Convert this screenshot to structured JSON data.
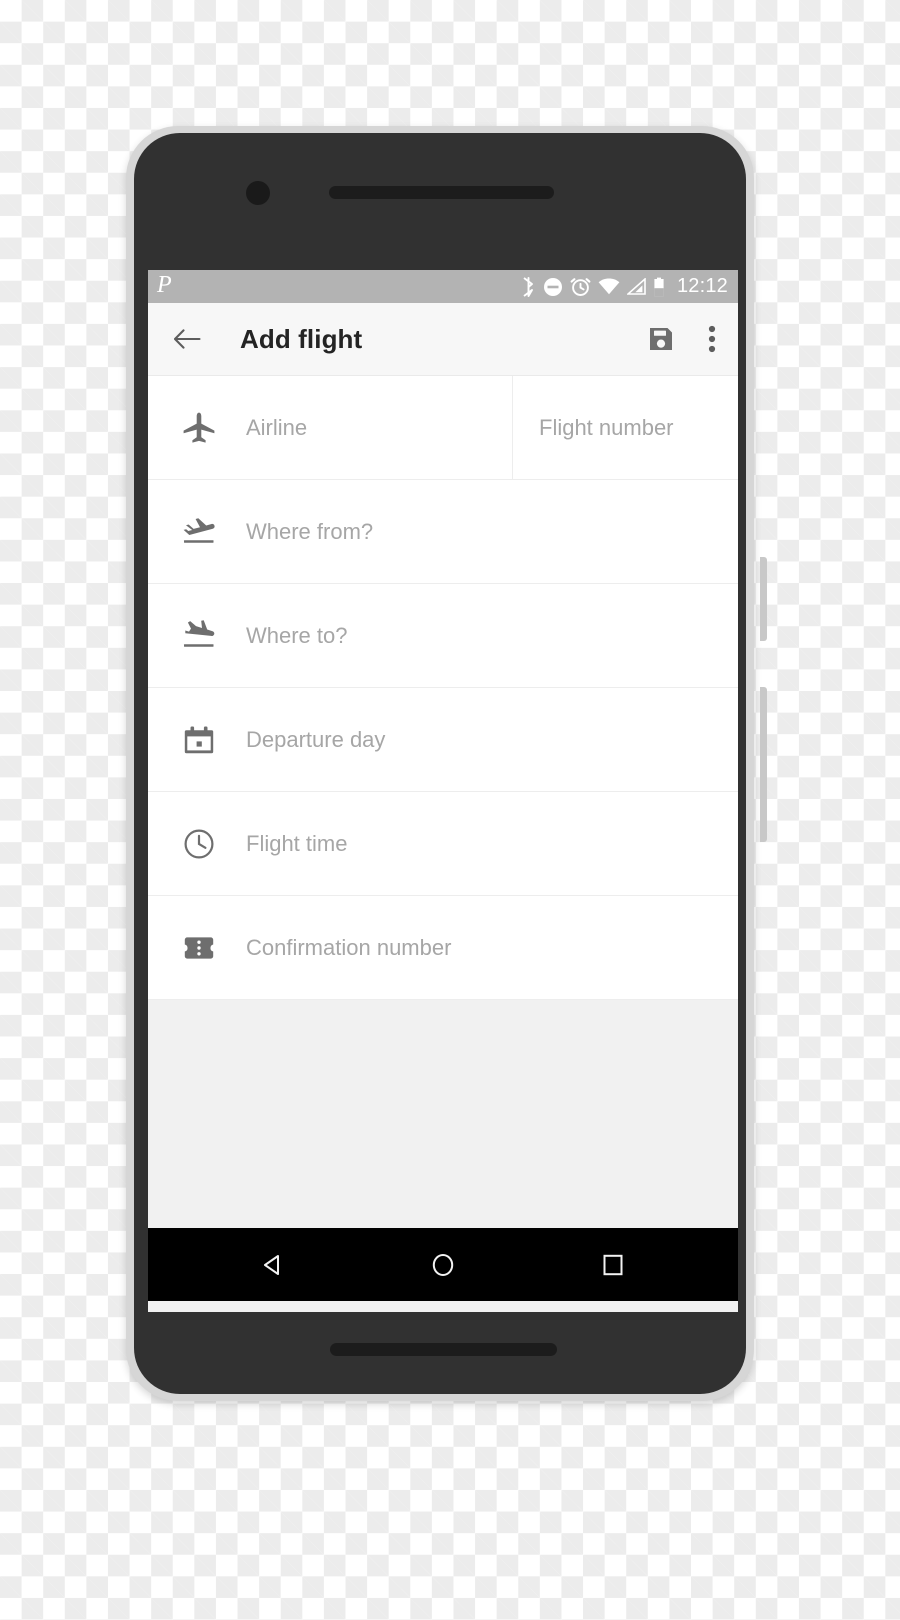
{
  "status_bar": {
    "app_logo": "P",
    "clock": "12:12",
    "icons": [
      "bluetooth-icon",
      "do-not-disturb-icon",
      "alarm-icon",
      "wifi-icon",
      "cellular-signal-icon",
      "battery-icon"
    ],
    "background_color": "#b3b3b3",
    "foreground_color": "#ffffff"
  },
  "toolbar": {
    "back_icon": "arrow-back-icon",
    "title": "Add flight",
    "save_icon": "save-floppy-disk-icon",
    "overflow_icon": "more-vert-icon",
    "background_color": "#f7f7f7",
    "title_color": "#242424"
  },
  "form": {
    "placeholder_color": "#a6a6a6",
    "icon_color": "#6e6e6e",
    "rows": [
      {
        "icon": "airplane-icon",
        "placeholder": "Airline",
        "value": "",
        "secondary_field": {
          "placeholder": "Flight number",
          "value": ""
        }
      },
      {
        "icon": "flight-takeoff-icon",
        "placeholder": "Where from?",
        "value": ""
      },
      {
        "icon": "flight-land-icon",
        "placeholder": "Where to?",
        "value": ""
      },
      {
        "icon": "calendar-icon",
        "placeholder": "Departure day",
        "value": ""
      },
      {
        "icon": "clock-icon",
        "placeholder": "Flight time",
        "value": ""
      },
      {
        "icon": "confirmation-number-ticket-icon",
        "placeholder": "Confirmation number",
        "value": ""
      }
    ]
  },
  "nav_bar": {
    "background_color": "#000000",
    "buttons": [
      {
        "icon": "nav-back-triangle-icon",
        "label": "Back"
      },
      {
        "icon": "nav-home-circle-icon",
        "label": "Home"
      },
      {
        "icon": "nav-recents-square-icon",
        "label": "Recents"
      }
    ]
  },
  "device": {
    "frame_color": "#313131",
    "bezel_color": "#d6d6d6",
    "hardware": [
      "camera-lens",
      "speaker-top",
      "speaker-bottom",
      "side-button-power",
      "side-button-volume"
    ]
  }
}
